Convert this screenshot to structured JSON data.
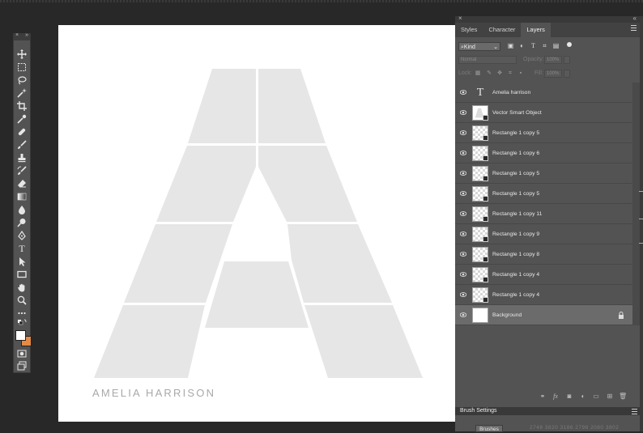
{
  "tools": {
    "items": [
      "move-tool",
      "marquee-tool",
      "lasso-tool",
      "quick-selection-tool",
      "crop-tool",
      "eyedropper-tool",
      "healing-brush-tool",
      "brush-tool",
      "clone-stamp-tool",
      "history-brush-tool",
      "eraser-tool",
      "gradient-tool",
      "blur-tool",
      "dodge-tool",
      "pen-tool",
      "type-tool",
      "path-selection-tool",
      "rectangle-tool",
      "hand-tool",
      "zoom-tool",
      "more-tools"
    ],
    "type_glyph": "T",
    "foreground_color": "#ffffff",
    "background_color": "#e58a45"
  },
  "canvas": {
    "name_text": "AMELIA HARRISON",
    "shape_color": "#e6e6e6"
  },
  "layers_panel": {
    "tabs": [
      "Styles",
      "Character",
      "Layers"
    ],
    "active_tab": "Layers",
    "filter_kind": "Kind",
    "blend_mode": "Normal",
    "opacity_label": "Opacity:",
    "opacity_value": "100%",
    "lock_label": "Lock:",
    "fill_label": "Fill:",
    "fill_value": "100%",
    "type_glyph": "T",
    "layers": [
      {
        "name": "Amelia harrison",
        "kind": "text"
      },
      {
        "name": "Vector Smart Object",
        "kind": "smart"
      },
      {
        "name": "Rectangle 1 copy 5",
        "kind": "raster"
      },
      {
        "name": "Rectangle 1 copy 6",
        "kind": "raster"
      },
      {
        "name": "Rectangle 1 copy 5",
        "kind": "raster"
      },
      {
        "name": "Rectangle 1 copy 5",
        "kind": "raster"
      },
      {
        "name": "Rectangle 1 copy 11",
        "kind": "raster"
      },
      {
        "name": "Rectangle 1 copy 9",
        "kind": "raster"
      },
      {
        "name": "Rectangle 1 copy 8",
        "kind": "raster"
      },
      {
        "name": "Rectangle 1 copy 4",
        "kind": "raster"
      },
      {
        "name": "Rectangle 1 copy 4",
        "kind": "raster"
      },
      {
        "name": "Background",
        "kind": "background",
        "selected": true,
        "locked": true
      }
    ]
  },
  "brush_panel": {
    "title": "Brush Settings",
    "brushes_button": "Brushes",
    "preset_sizes": "2748  3820  3186  2798  2080  3802"
  }
}
